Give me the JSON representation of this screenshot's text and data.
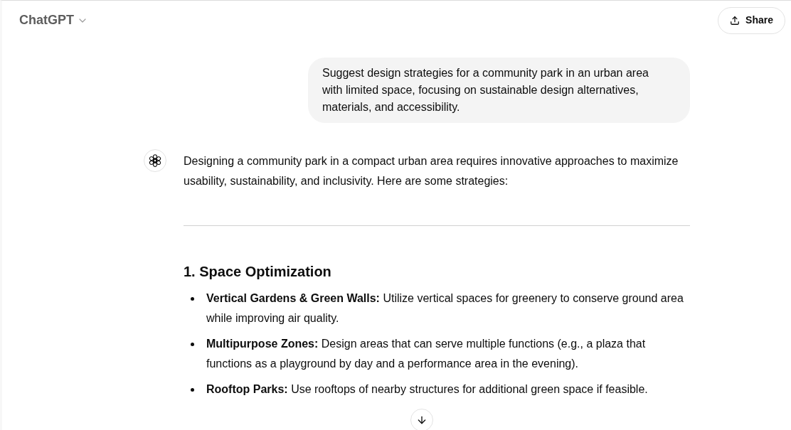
{
  "header": {
    "title": "ChatGPT",
    "share_button": "Share"
  },
  "messages": [
    {
      "kind": "user",
      "text": "Suggest design strategies for a community park in an urban area with limited space, focusing on sustainable design alternatives, materials, and accessibility."
    },
    {
      "kind": "assistant",
      "intro": "Designing a community park in a compact urban area requires innovative approaches to maximize usability, sustainability, and inclusivity. Here are some strategies:",
      "sections": [
        {
          "heading": "1. Space Optimization",
          "items": [
            {
              "term": "Vertical Gardens & Green Walls:",
              "text": "Utilize vertical spaces for greenery to conserve ground area while improving air quality."
            },
            {
              "term": "Multipurpose Zones:",
              "text": "Design areas that can serve multiple functions (e.g., a plaza that functions as a playground by day and a performance area in the evening)."
            },
            {
              "term": "Rooftop Parks:",
              "text": "Use rooftops of nearby structures for additional green space if feasible."
            }
          ]
        }
      ]
    }
  ]
}
